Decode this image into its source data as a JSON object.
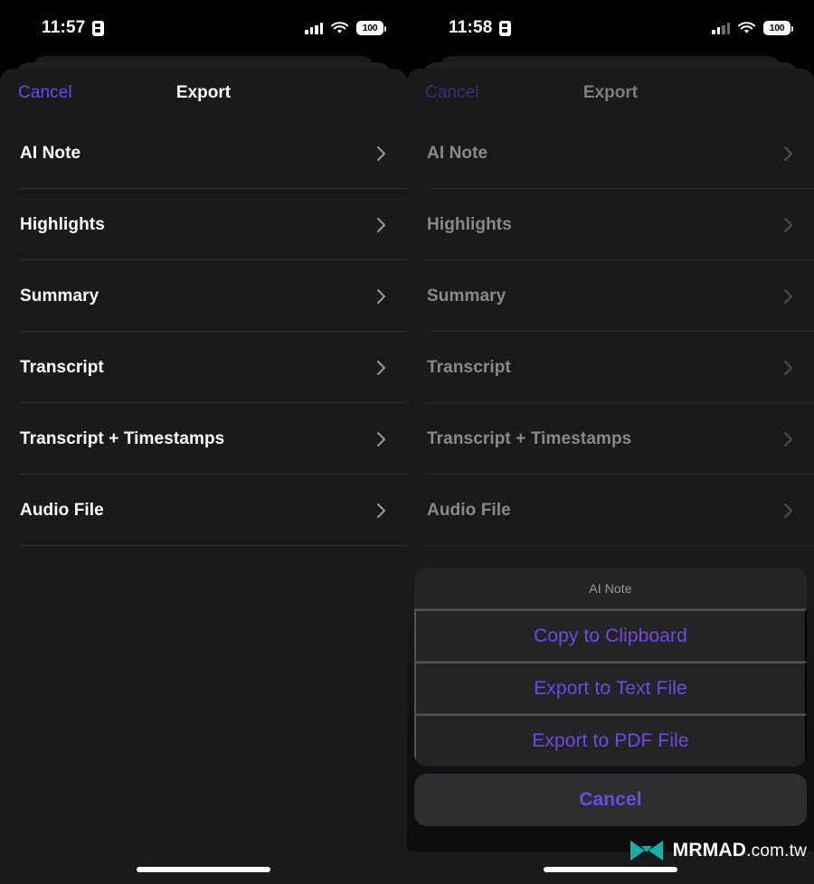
{
  "panels": {
    "left": {
      "status_bar": {
        "time": "11:57",
        "recording_icon": "record-indicator-icon",
        "signal_icon": "cellular-signal-icon",
        "wifi_icon": "wifi-icon",
        "battery_level": "100"
      },
      "nav": {
        "cancel_label": "Cancel",
        "title": "Export"
      },
      "rows": [
        {
          "label": "AI Note"
        },
        {
          "label": "Highlights"
        },
        {
          "label": "Summary"
        },
        {
          "label": "Transcript"
        },
        {
          "label": "Transcript + Timestamps"
        },
        {
          "label": "Audio File"
        }
      ]
    },
    "right": {
      "status_bar": {
        "time": "11:58",
        "recording_icon": "record-indicator-icon",
        "signal_icon": "cellular-signal-icon",
        "wifi_icon": "wifi-icon",
        "battery_level": "100"
      },
      "nav": {
        "cancel_label": "Cancel",
        "title": "Export"
      },
      "rows": [
        {
          "label": "AI Note"
        },
        {
          "label": "Highlights"
        },
        {
          "label": "Summary"
        },
        {
          "label": "Transcript"
        },
        {
          "label": "Transcript + Timestamps"
        },
        {
          "label": "Audio File"
        }
      ],
      "action_sheet": {
        "title": "AI Note",
        "options": [
          {
            "label": "Copy to Clipboard"
          },
          {
            "label": "Export to Text File"
          },
          {
            "label": "Export to PDF File"
          }
        ],
        "cancel_label": "Cancel"
      }
    }
  },
  "watermark": {
    "brand": "MRMAD",
    "domain": ".com.tw",
    "logo_color": "#18ada8"
  },
  "colors": {
    "accent_purple": "#6C4BE8",
    "accent_purple_dim": "#3c2c72",
    "sheet_background": "#1a1a1c",
    "action_sheet_background": "#242426",
    "divider": "#303033",
    "text_primary": "#ffffff",
    "text_dimmed": "#89898c",
    "text_secondary": "#9a9a9e"
  }
}
